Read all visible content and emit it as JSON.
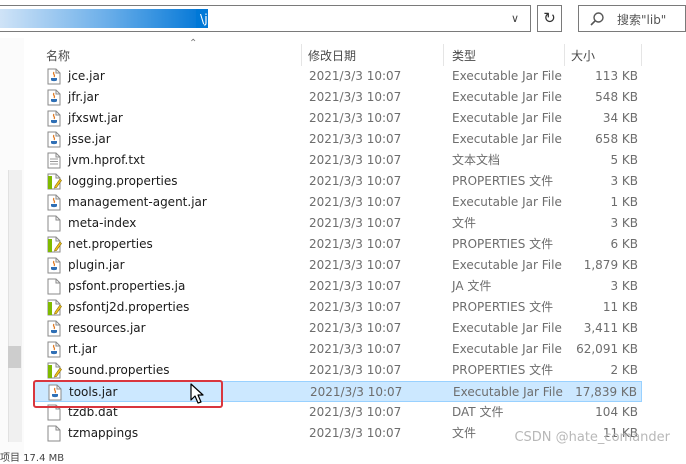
{
  "address": {
    "path": "\\jre1.8.0\\lib"
  },
  "search": {
    "placeholder": "搜索\"lib\""
  },
  "columns": {
    "name": "名称",
    "date": "修改日期",
    "type": "类型",
    "size": "大小"
  },
  "files": [
    {
      "name": "jce.jar",
      "date": "2021/3/3 10:07",
      "type": "Executable Jar File",
      "size": "113 KB",
      "icon": "jar-file-icon"
    },
    {
      "name": "jfr.jar",
      "date": "2021/3/3 10:07",
      "type": "Executable Jar File",
      "size": "548 KB",
      "icon": "jar-file-icon"
    },
    {
      "name": "jfxswt.jar",
      "date": "2021/3/3 10:07",
      "type": "Executable Jar File",
      "size": "34 KB",
      "icon": "jar-file-icon"
    },
    {
      "name": "jsse.jar",
      "date": "2021/3/3 10:07",
      "type": "Executable Jar File",
      "size": "658 KB",
      "icon": "jar-file-icon"
    },
    {
      "name": "jvm.hprof.txt",
      "date": "2021/3/3 10:07",
      "type": "文本文档",
      "size": "5 KB",
      "icon": "text-file-icon"
    },
    {
      "name": "logging.properties",
      "date": "2021/3/3 10:07",
      "type": "PROPERTIES 文件",
      "size": "3 KB",
      "icon": "properties-file-icon"
    },
    {
      "name": "management-agent.jar",
      "date": "2021/3/3 10:07",
      "type": "Executable Jar File",
      "size": "1 KB",
      "icon": "jar-file-icon"
    },
    {
      "name": "meta-index",
      "date": "2021/3/3 10:07",
      "type": "文件",
      "size": "3 KB",
      "icon": "blank-file-icon"
    },
    {
      "name": "net.properties",
      "date": "2021/3/3 10:07",
      "type": "PROPERTIES 文件",
      "size": "6 KB",
      "icon": "properties-file-icon"
    },
    {
      "name": "plugin.jar",
      "date": "2021/3/3 10:07",
      "type": "Executable Jar File",
      "size": "1,879 KB",
      "icon": "jar-file-icon"
    },
    {
      "name": "psfont.properties.ja",
      "date": "2021/3/3 10:07",
      "type": "JA 文件",
      "size": "3 KB",
      "icon": "blank-file-icon"
    },
    {
      "name": "psfontj2d.properties",
      "date": "2021/3/3 10:07",
      "type": "PROPERTIES 文件",
      "size": "11 KB",
      "icon": "properties-file-icon"
    },
    {
      "name": "resources.jar",
      "date": "2021/3/3 10:07",
      "type": "Executable Jar File",
      "size": "3,411 KB",
      "icon": "jar-file-icon"
    },
    {
      "name": "rt.jar",
      "date": "2021/3/3 10:07",
      "type": "Executable Jar File",
      "size": "62,091 KB",
      "icon": "jar-file-icon"
    },
    {
      "name": "sound.properties",
      "date": "2021/3/3 10:07",
      "type": "PROPERTIES 文件",
      "size": "2 KB",
      "icon": "properties-file-icon"
    },
    {
      "name": "tools.jar",
      "date": "2021/3/3 10:07",
      "type": "Executable Jar File",
      "size": "17,839 KB",
      "icon": "jar-file-icon",
      "selected": true
    },
    {
      "name": "tzdb.dat",
      "date": "2021/3/3 10:07",
      "type": "DAT 文件",
      "size": "104 KB",
      "icon": "blank-file-icon"
    },
    {
      "name": "tzmappings",
      "date": "2021/3/3 10:07",
      "type": "文件",
      "size": "11 KB",
      "icon": "blank-file-icon"
    }
  ],
  "status": {
    "text": "项目 17.4 MB"
  },
  "watermark": "CSDN @hate_comander",
  "colors": {
    "selection": "#cce8ff",
    "highlight_box": "#d9363e",
    "address_selection": "#0078d7"
  }
}
